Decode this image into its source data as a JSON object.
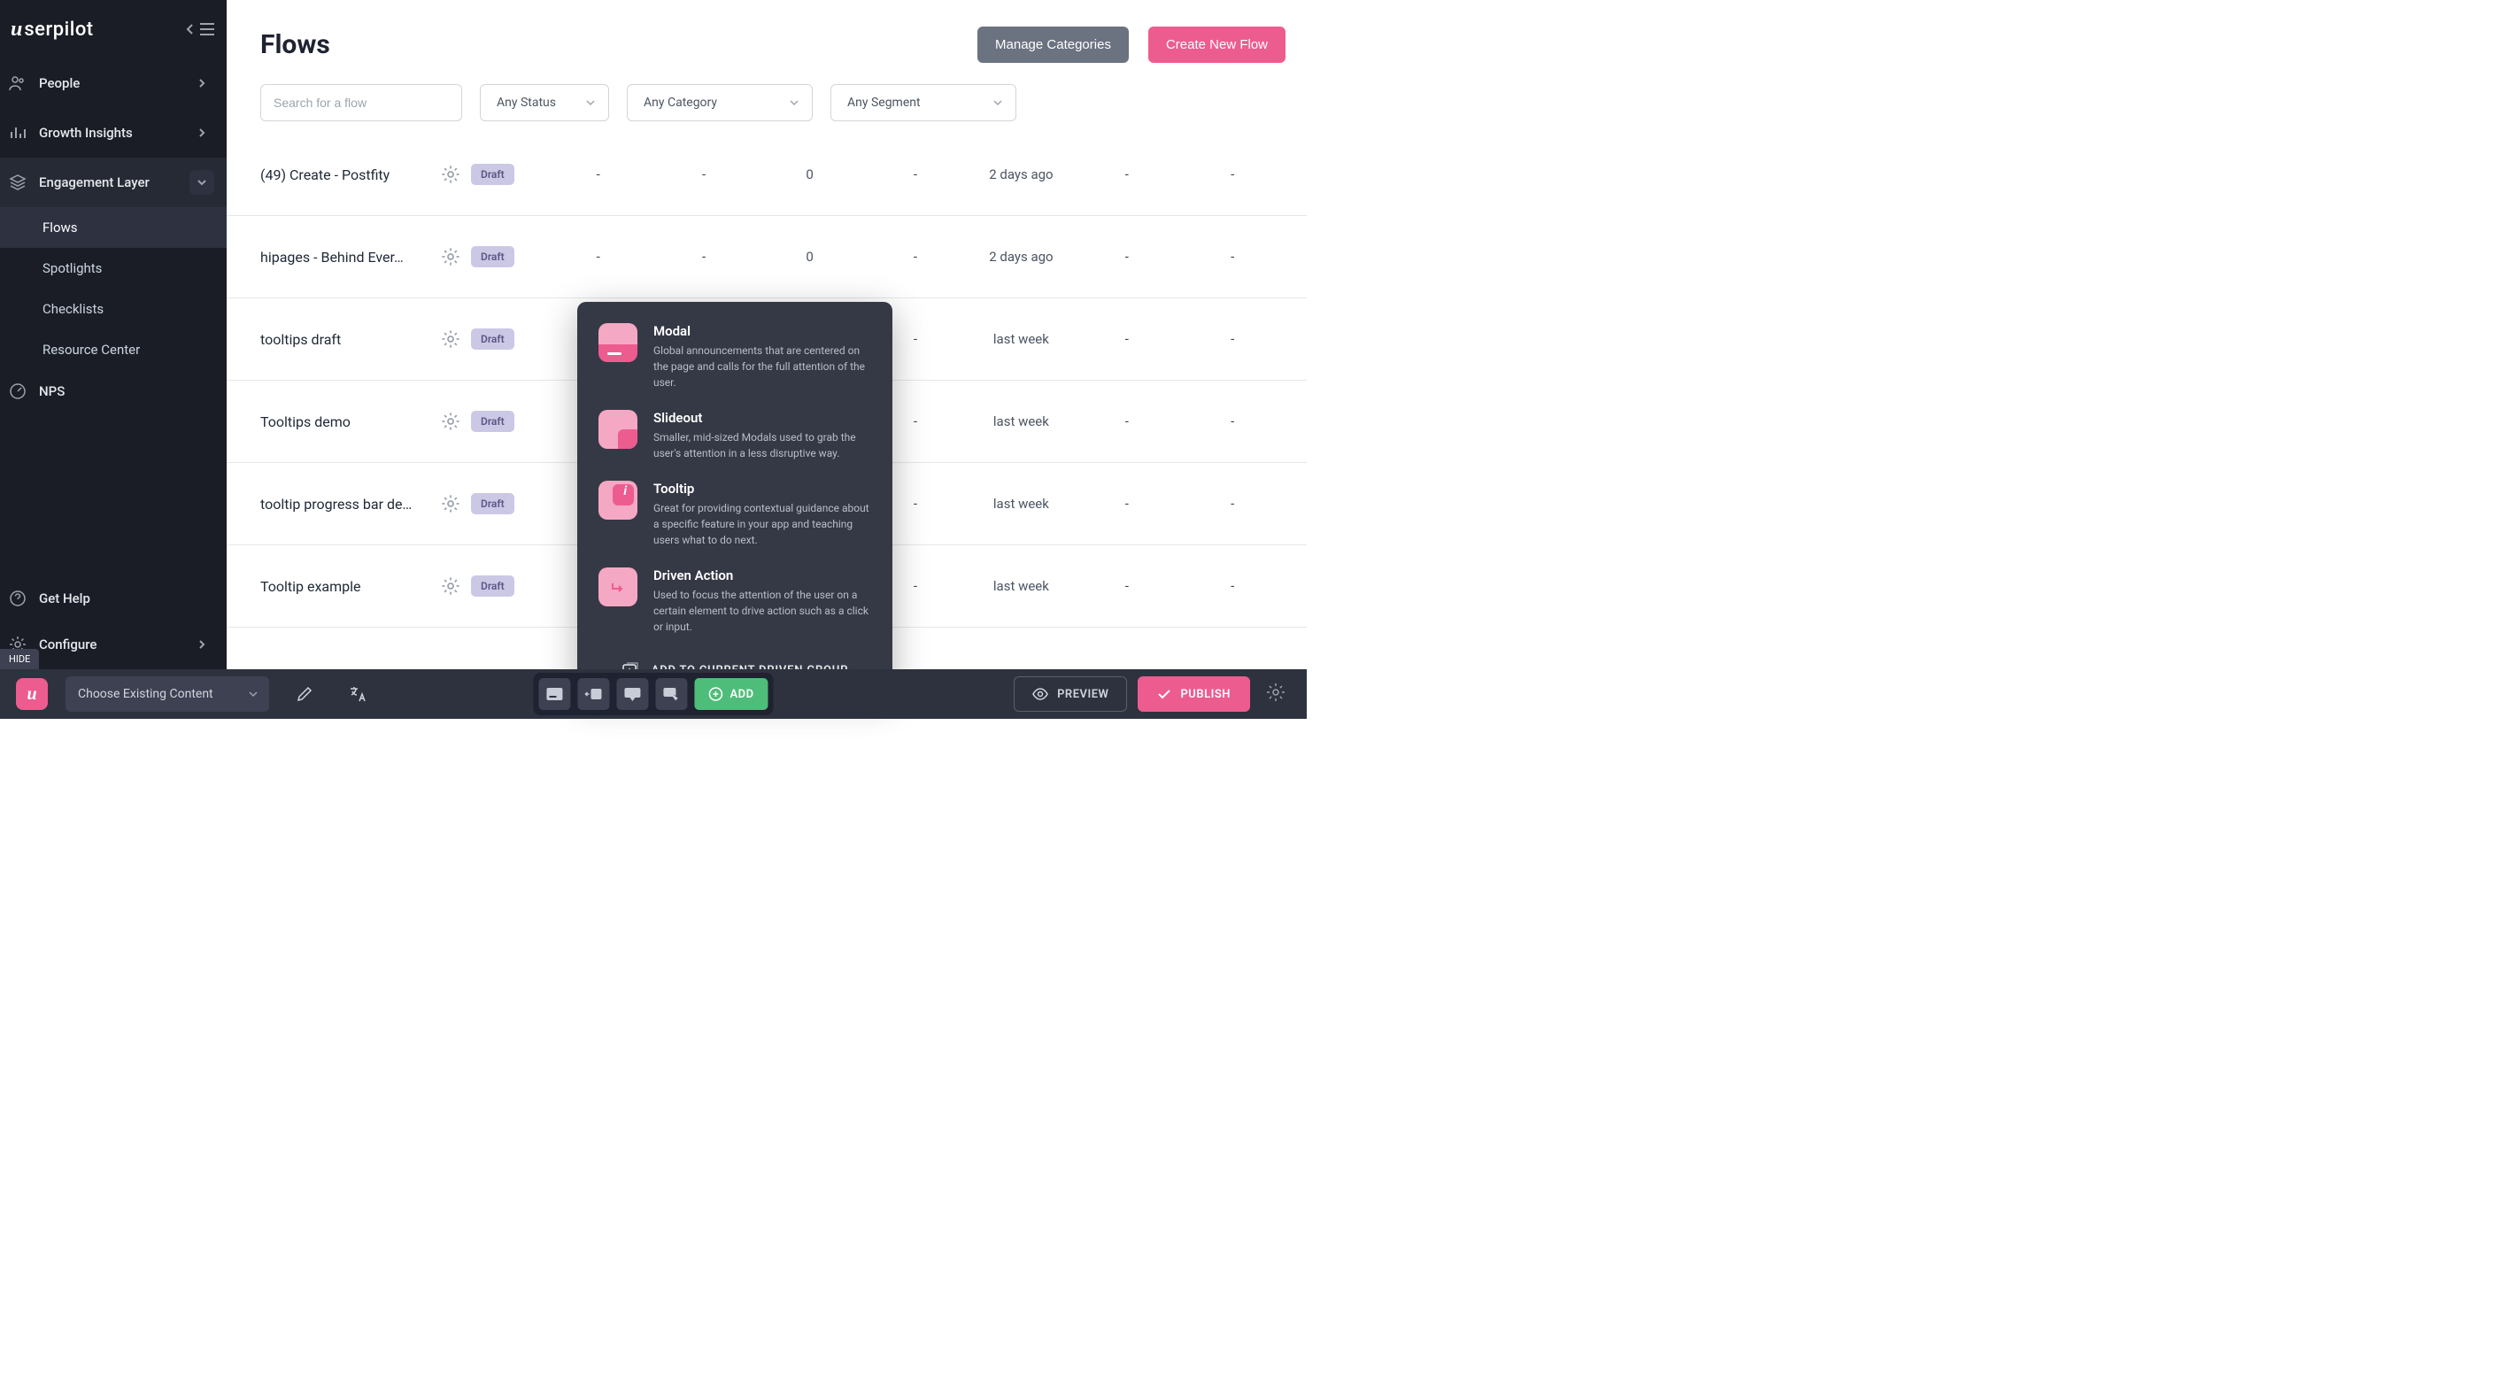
{
  "logo": {
    "prefix": "u",
    "text": "serpilot"
  },
  "sidebar": {
    "items": [
      {
        "label": "People"
      },
      {
        "label": "Growth Insights"
      },
      {
        "label": "Engagement Layer"
      },
      {
        "label": "NPS"
      }
    ],
    "sub_items": [
      {
        "label": "Flows"
      },
      {
        "label": "Spotlights"
      },
      {
        "label": "Checklists"
      },
      {
        "label": "Resource Center"
      }
    ],
    "bottom": [
      {
        "label": "Get Help"
      },
      {
        "label": "Configure"
      }
    ],
    "hide_label": "HIDE"
  },
  "header": {
    "title": "Flows",
    "manage_categories": "Manage Categories",
    "create_new_flow": "Create New Flow"
  },
  "filters": {
    "search_placeholder": "Search for a flow",
    "status": "Any Status",
    "category": "Any Category",
    "segment": "Any Segment"
  },
  "rows": [
    {
      "name": "(49) Create - Postfity",
      "badge": "Draft",
      "c1": "-",
      "c2": "-",
      "c3": "0",
      "c4": "-",
      "c5": "2 days ago",
      "c6": "-",
      "c7": "-"
    },
    {
      "name": "hipages - Behind Ever…",
      "badge": "Draft",
      "c1": "-",
      "c2": "-",
      "c3": "0",
      "c4": "-",
      "c5": "2 days ago",
      "c6": "-",
      "c7": "-"
    },
    {
      "name": "tooltips draft",
      "badge": "Draft",
      "c1": "-",
      "c2": "",
      "c3": "",
      "c4": "-",
      "c5": "last week",
      "c6": "-",
      "c7": "-"
    },
    {
      "name": "Tooltips demo",
      "badge": "Draft",
      "c1": "-",
      "c2": "",
      "c3": "",
      "c4": "-",
      "c5": "last week",
      "c6": "-",
      "c7": "-"
    },
    {
      "name": "tooltip progress bar de…",
      "badge": "Draft",
      "c1": "-",
      "c2": "",
      "c3": "",
      "c4": "-",
      "c5": "last week",
      "c6": "-",
      "c7": "-"
    },
    {
      "name": "Tooltip example",
      "badge": "Draft",
      "c1": "-",
      "c2": "",
      "c3": "",
      "c4": "-",
      "c5": "last week",
      "c6": "-",
      "c7": "-"
    }
  ],
  "popover": {
    "items": [
      {
        "title": "Modal",
        "desc": "Global announcements that are centered on the page and calls for the full attention of the user."
      },
      {
        "title": "Slideout",
        "desc": "Smaller, mid-sized Modals used to grab the user's attention in a less disruptive way."
      },
      {
        "title": "Tooltip",
        "desc": "Great for providing contextual guidance about a specific feature in your app and teaching users what to do next."
      },
      {
        "title": "Driven Action",
        "desc": "Used to focus the attention of the user on a certain element to drive action such as a click or input."
      }
    ],
    "footer": "ADD TO CURRENT DRIVEN GROUP"
  },
  "bottom_bar": {
    "choose_content": "Choose Existing Content",
    "add": "ADD",
    "preview": "PREVIEW",
    "publish": "PUBLISH"
  },
  "colors": {
    "sidebar_bg": "#1a1d26",
    "accent": "#ed5c8f",
    "secondary": "#6b7280",
    "badge_bg": "#cbc8e6",
    "add_green": "#4fbd7a"
  }
}
